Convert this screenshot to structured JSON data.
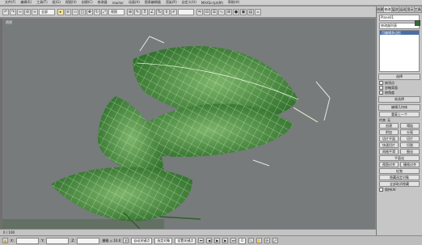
{
  "menubar": {
    "items": [
      "文件(F)",
      "编辑(E)",
      "工具(T)",
      "组(G)",
      "视图(V)",
      "创建(C)",
      "修改器",
      "reactor",
      "动画(A)",
      "图表编辑器",
      "渲染(R)",
      "自定义(U)",
      "MAXScript(M)",
      "帮助(H)"
    ]
  },
  "toolbar": {
    "selection_filter": "全部",
    "view_select": "视图",
    "named_selection": ""
  },
  "viewport": {
    "label": "透视"
  },
  "panel": {
    "tabs": [
      "创建",
      "修改",
      "层次",
      "运动",
      "显示",
      "工具"
    ],
    "object_name": "Plane01",
    "modifier_list_label": "修改器列表",
    "stack_item": "可编辑多边形",
    "rollout_selection": "选择",
    "by_vertex": "按顶点",
    "ignore_backfacing": "忽略背面",
    "by_angle": "按角度",
    "rollout_soft": "软选择",
    "rollout_edit_geometry": "编辑几何体",
    "repeat_last": "重复上一个",
    "constraints": "约束",
    "none_label": "无",
    "create_btn": "创建",
    "collapse_btn": "塌陷",
    "attach_btn": "附加",
    "detach_btn": "分离",
    "slice_plane": "切片平面",
    "slice": "切片",
    "cut": "切割",
    "quickslice": "快速切片",
    "msmooth": "网格平滑",
    "tessellate": "细化",
    "make_planar": "平面化",
    "view_align": "视图对齐",
    "grid_align": "栅格对齐",
    "relax": "松弛",
    "hide_selected": "隐藏选定对象",
    "unhide_all": "全部取消隐藏",
    "preserve_uvs": "保持UV"
  },
  "status": {
    "frame": "0 / 100",
    "x": "X:",
    "y": "Y:",
    "z": "Z:",
    "grid": "栅格 = 10.0"
  },
  "bottombar": {
    "auto_key": "自动关键点",
    "set_key": "设置关键点",
    "selected": "选定对象",
    "frame_num": "0"
  }
}
